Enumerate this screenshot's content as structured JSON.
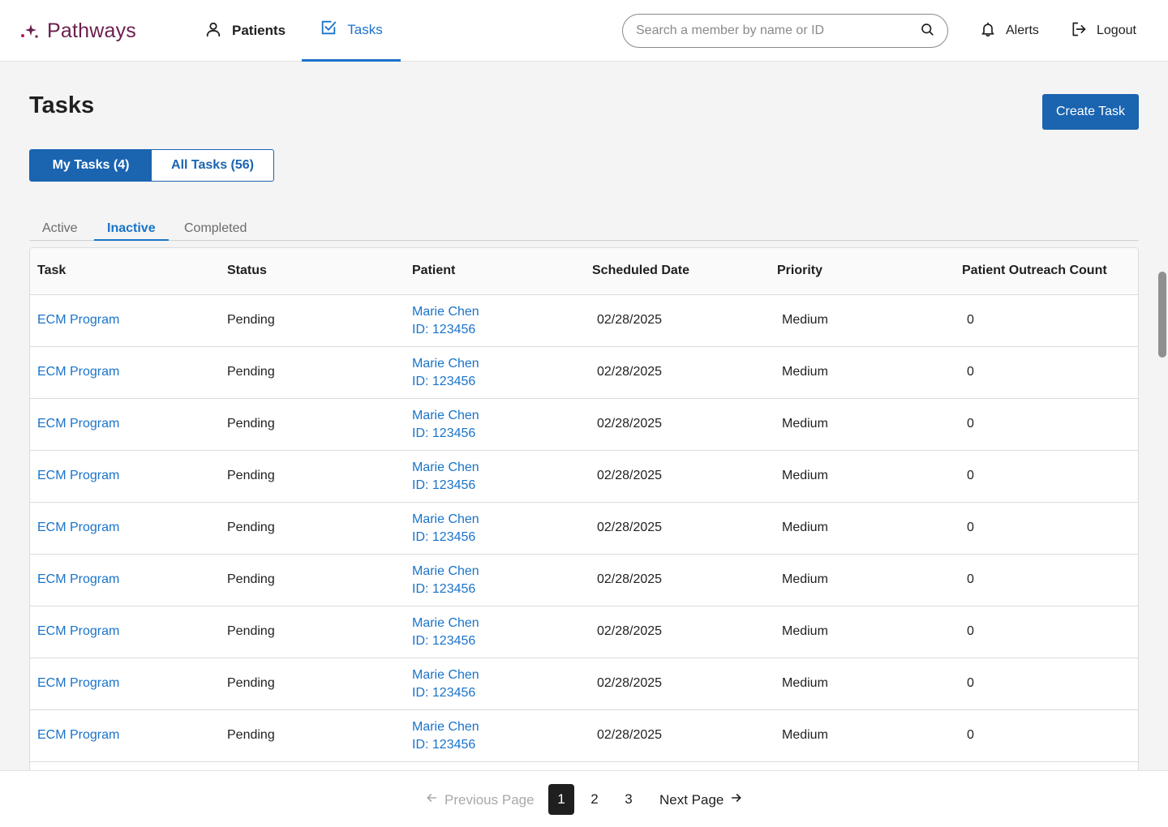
{
  "brand": {
    "name": "Pathways"
  },
  "nav": {
    "patients_label": "Patients",
    "tasks_label": "Tasks"
  },
  "search": {
    "placeholder": "Search a member by name or ID"
  },
  "header": {
    "alerts_label": "Alerts",
    "logout_label": "Logout"
  },
  "page": {
    "title": "Tasks",
    "create_label": "Create Task"
  },
  "segments": [
    {
      "label": "My Tasks (4)",
      "active": true
    },
    {
      "label": "All Tasks (56)",
      "active": false
    }
  ],
  "subtabs": [
    {
      "label": "Active",
      "active": false
    },
    {
      "label": "Inactive",
      "active": true
    },
    {
      "label": "Completed",
      "active": false
    }
  ],
  "table": {
    "columns": [
      "Task",
      "Status",
      "Patient",
      "Scheduled Date",
      "Priority",
      "Patient Outreach Count"
    ],
    "rows": [
      {
        "task": "ECM Program",
        "status": "Pending",
        "patient_name": "Marie Chen",
        "patient_id": "ID: 123456",
        "date": "02/28/2025",
        "priority": "Medium",
        "count": "0"
      },
      {
        "task": "ECM Program",
        "status": "Pending",
        "patient_name": "Marie Chen",
        "patient_id": "ID: 123456",
        "date": "02/28/2025",
        "priority": "Medium",
        "count": "0"
      },
      {
        "task": "ECM Program",
        "status": "Pending",
        "patient_name": "Marie Chen",
        "patient_id": "ID: 123456",
        "date": "02/28/2025",
        "priority": "Medium",
        "count": "0"
      },
      {
        "task": "ECM Program",
        "status": "Pending",
        "patient_name": "Marie Chen",
        "patient_id": "ID: 123456",
        "date": "02/28/2025",
        "priority": "Medium",
        "count": "0"
      },
      {
        "task": "ECM Program",
        "status": "Pending",
        "patient_name": "Marie Chen",
        "patient_id": "ID: 123456",
        "date": "02/28/2025",
        "priority": "Medium",
        "count": "0"
      },
      {
        "task": "ECM Program",
        "status": "Pending",
        "patient_name": "Marie Chen",
        "patient_id": "ID: 123456",
        "date": "02/28/2025",
        "priority": "Medium",
        "count": "0"
      },
      {
        "task": "ECM Program",
        "status": "Pending",
        "patient_name": "Marie Chen",
        "patient_id": "ID: 123456",
        "date": "02/28/2025",
        "priority": "Medium",
        "count": "0"
      },
      {
        "task": "ECM Program",
        "status": "Pending",
        "patient_name": "Marie Chen",
        "patient_id": "ID: 123456",
        "date": "02/28/2025",
        "priority": "Medium",
        "count": "0"
      },
      {
        "task": "ECM Program",
        "status": "Pending",
        "patient_name": "Marie Chen",
        "patient_id": "ID: 123456",
        "date": "02/28/2025",
        "priority": "Medium",
        "count": "0"
      }
    ]
  },
  "pagination": {
    "prev_label": "Previous Page",
    "next_label": "Next Page",
    "pages": [
      "1",
      "2",
      "3"
    ],
    "current": "1"
  },
  "colors": {
    "accent": "#1a73c9",
    "primary_button": "#1a64b0",
    "brand": "#6b1e4e",
    "page_bg": "#f4f4f4"
  },
  "icons": {
    "logo": "sparkle-icon",
    "patients": "person-icon",
    "tasks": "checkbox-icon",
    "search": "search-icon",
    "alerts": "bell-icon",
    "logout": "logout-icon",
    "prev": "arrow-left-icon",
    "next": "arrow-right-icon"
  }
}
